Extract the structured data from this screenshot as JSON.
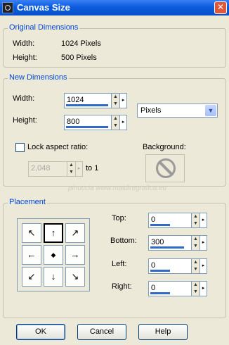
{
  "window": {
    "title": "Canvas Size",
    "close_glyph": "✕"
  },
  "original": {
    "group_title": "Original Dimensions",
    "width_label": "Width:",
    "width_value": "1024 Pixels",
    "height_label": "Height:",
    "height_value": "500 Pixels"
  },
  "new_dimensions": {
    "group_title": "New Dimensions",
    "width_label": "Width:",
    "width_value": "1024",
    "height_label": "Height:",
    "height_value": "800",
    "units_selected": "Pixels",
    "lock_label": "Lock aspect ratio:",
    "lock_checked": false,
    "ratio_value": "2,048",
    "ratio_suffix": "to 1",
    "background_label": "Background:"
  },
  "placement": {
    "group_title": "Placement",
    "selected_anchor": "top-center",
    "anchors": [
      {
        "name": "top-left",
        "glyph": "↖"
      },
      {
        "name": "top-center",
        "glyph": "↑"
      },
      {
        "name": "top-right",
        "glyph": "↗"
      },
      {
        "name": "middle-left",
        "glyph": "←"
      },
      {
        "name": "center",
        "glyph": "◆"
      },
      {
        "name": "middle-right",
        "glyph": "→"
      },
      {
        "name": "bottom-left",
        "glyph": "↙"
      },
      {
        "name": "bottom-center",
        "glyph": "↓"
      },
      {
        "name": "bottom-right",
        "glyph": "↘"
      }
    ],
    "top_label": "Top:",
    "top_value": "0",
    "bottom_label": "Bottom:",
    "bottom_value": "300",
    "left_label": "Left:",
    "left_value": "0",
    "right_label": "Right:",
    "right_value": "0"
  },
  "buttons": {
    "ok": "OK",
    "cancel": "Cancel",
    "help": "Help"
  },
  "watermark": "pinuccia www.maidiregrafica.eu",
  "colors": {
    "title_bar": "#0a4fc7",
    "group_title": "#0046d5",
    "dialog_bg": "#ece9d8",
    "field_border": "#7f9db9",
    "field_bar": "#316ac5"
  }
}
